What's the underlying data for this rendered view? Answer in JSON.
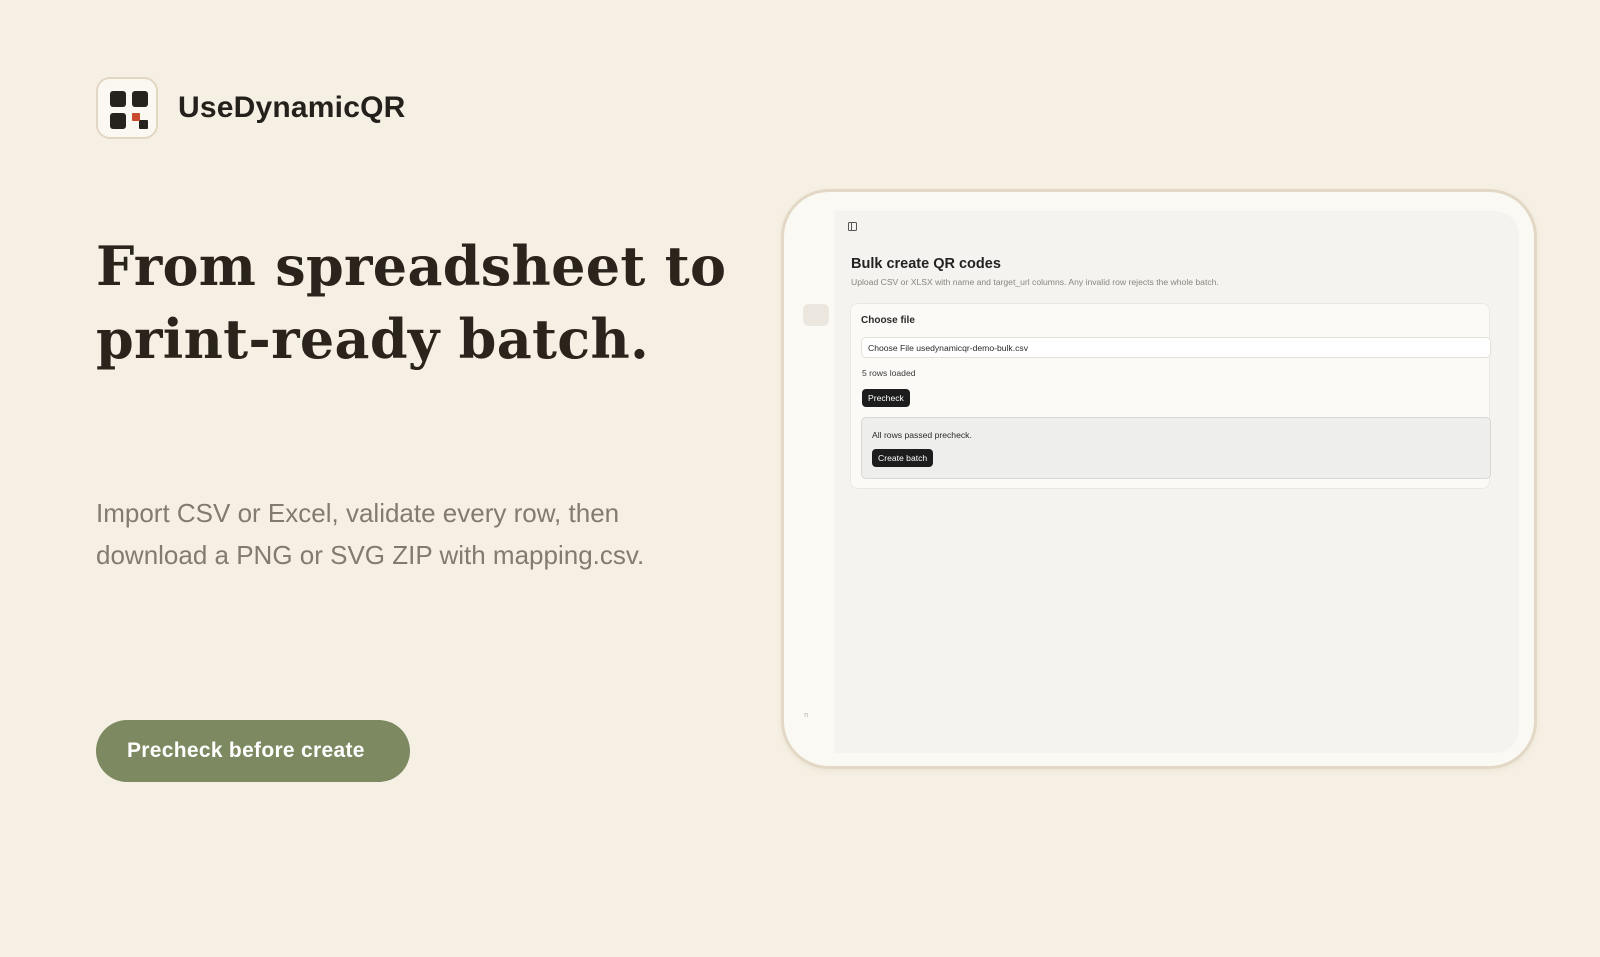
{
  "brand": {
    "name": "UseDynamicQR",
    "icon": "qr-logo-icon",
    "accent_color": "#c64c2d"
  },
  "hero": {
    "headline_line1": "From spreadsheet to",
    "headline_line2": "print-ready batch.",
    "subhead_line1": "Import CSV or Excel, validate every row, then",
    "subhead_line2": "download a PNG or SVG ZIP with mapping.csv.",
    "cta_label": "Precheck before create",
    "cta_color": "#7c8961"
  },
  "app": {
    "sidebar_toggle_icon": "sidebar-toggle-icon",
    "title": "Bulk create QR codes",
    "subtitle": "Upload CSV or XLSX with name and target_url columns. Any invalid row rejects the whole batch.",
    "file_section_label": "Choose file",
    "file_input_value": "Choose File usedynamicqr-demo-bulk.csv",
    "rows_loaded": "5 rows loaded",
    "precheck_button": "Precheck",
    "result_message": "All rows passed precheck.",
    "create_button": "Create batch",
    "rail_mark": "n"
  }
}
